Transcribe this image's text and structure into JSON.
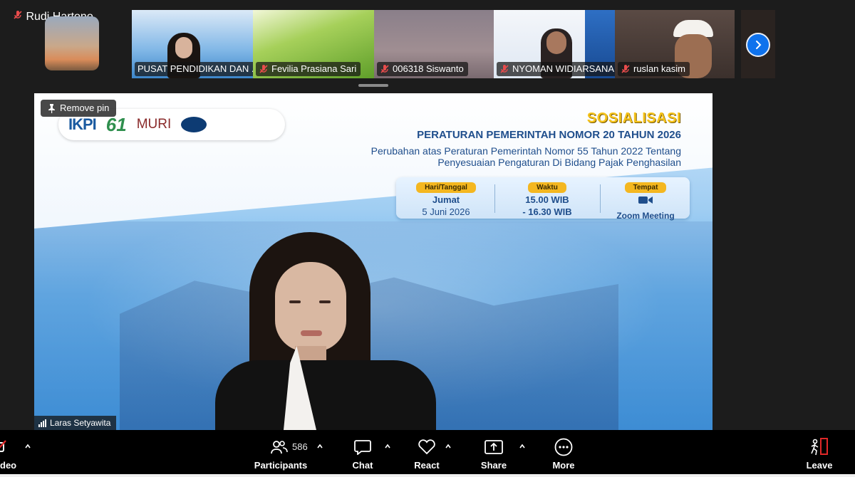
{
  "participants_strip": {
    "tiles": [
      {
        "name": "Rudi Hartono",
        "muted": true
      },
      {
        "name": "PUSAT PENDIDIKAN DAN ...",
        "muted": false
      },
      {
        "name": "Fevilia Prasiana Sari",
        "muted": true
      },
      {
        "name": "006318 Siswanto",
        "muted": true
      },
      {
        "name": "NYOMAN WIDIARSANA",
        "muted": true
      },
      {
        "name": "ruslan kasim",
        "muted": true
      }
    ],
    "next_icon": "chevron-right-icon"
  },
  "main_video": {
    "pin_label": "Remove pin",
    "speaker_name": "Laras Setyawita",
    "banner": {
      "logos": [
        "IKPI",
        "61",
        "MURI"
      ],
      "headline": "SOSIALISASI",
      "title": "PERATURAN PEMERINTAH NOMOR 20 TAHUN 2026",
      "subtitle_line1": "Perubahan atas Peraturan Pemerintah Nomor 55 Tahun 2022 Tentang",
      "subtitle_line2": "Penyesuaian Pengaturan Di Bidang Pajak Penghasilan",
      "info": {
        "date_label": "Hari/Tanggal",
        "date_day": "Jumat",
        "date_value": "5 Juni 2026",
        "time_label": "Waktu",
        "time_start": "15.00 WIB",
        "time_end": "- 16.30 WIB",
        "place_label": "Tempat",
        "place_value": "Zoom Meeting"
      }
    }
  },
  "toolbar": {
    "video_label": "deo",
    "participants_label": "Participants",
    "participants_count": "586",
    "chat_label": "Chat",
    "react_label": "React",
    "share_label": "Share",
    "more_label": "More",
    "leave_label": "Leave",
    "accent_color": "#0e72ed",
    "leave_color": "#e02828"
  }
}
